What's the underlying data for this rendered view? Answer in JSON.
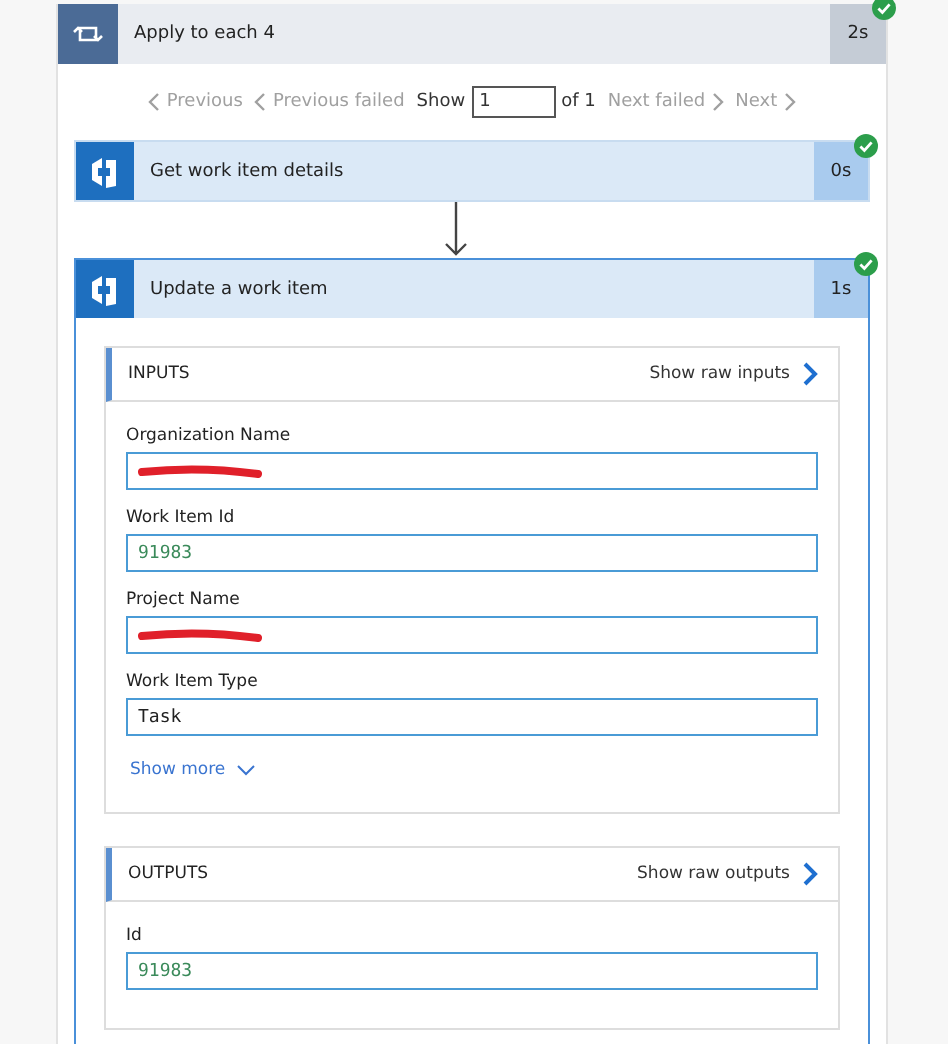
{
  "loop": {
    "title": "Apply to each 4",
    "duration": "2s",
    "succeeded": true
  },
  "pager": {
    "items": [
      {
        "label": "Previous",
        "kind": "prev",
        "disabled": true
      },
      {
        "label": "Previous failed",
        "kind": "prev",
        "disabled": true
      }
    ],
    "show_label": "Show",
    "value": "1",
    "of_label": "of 1",
    "next_items": [
      {
        "label": "Next failed",
        "kind": "next",
        "disabled": true
      },
      {
        "label": "Next",
        "kind": "next",
        "disabled": true
      }
    ]
  },
  "actions": [
    {
      "title": "Get work item details",
      "duration": "0s",
      "succeeded": true,
      "expanded": false
    },
    {
      "title": "Update a work item",
      "duration": "1s",
      "succeeded": true,
      "expanded": true,
      "inputs": {
        "title": "INPUTS",
        "raw_link": "Show raw inputs",
        "fields": [
          {
            "label": "Organization Name",
            "kind": "redacted"
          },
          {
            "label": "Work Item Id",
            "kind": "number",
            "value": "91983"
          },
          {
            "label": "Project Name",
            "kind": "redacted"
          },
          {
            "label": "Work Item Type",
            "kind": "string",
            "value": "Task"
          }
        ],
        "show_more": "Show more"
      },
      "outputs": {
        "title": "OUTPUTS",
        "raw_link": "Show raw outputs",
        "fields": [
          {
            "label": "Id",
            "kind": "number",
            "value": "91983"
          }
        ]
      }
    }
  ]
}
